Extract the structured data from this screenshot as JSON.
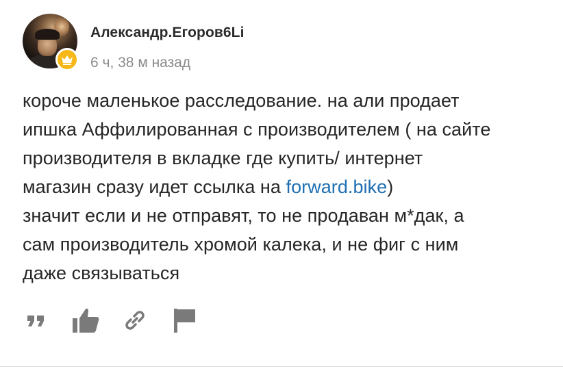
{
  "post": {
    "author": "Александр.Егоров6Li",
    "time": "6 ч, 38 м назад",
    "badge_icon": "crown-icon",
    "badge_color": "#f7b817",
    "comment": {
      "line1": "короче маленькое расследование. на али продает",
      "line2": "ипшка Аффилированная с производителем ( на сайте",
      "line3": "производителя в вкладке где купить/ интернет",
      "line4_before": "магазин сразу идет ссылка на ",
      "line4_link": "forward.bike",
      "line4_after": ")",
      "line5": "значит если и не отправят, то не продаван м*дак, а",
      "line6": "сам производитель хромой калека, и не фиг с ним",
      "line7": "даже связываться"
    },
    "link_color": "#1f6fb2"
  },
  "actions": [
    {
      "icon": "quote-icon"
    },
    {
      "icon": "thumbs-up-icon"
    },
    {
      "icon": "link-icon"
    },
    {
      "icon": "flag-icon"
    }
  ]
}
